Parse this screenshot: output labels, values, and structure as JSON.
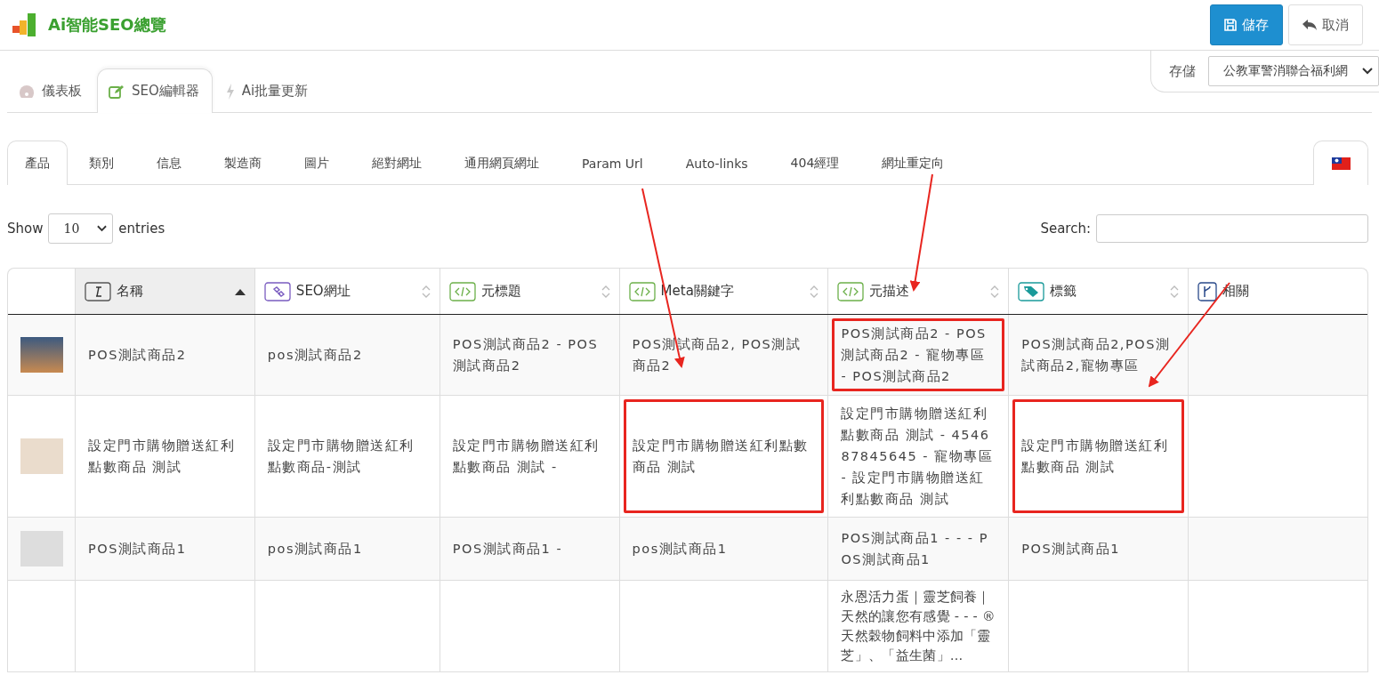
{
  "header": {
    "title": "Ai智能SEO總覽",
    "buttons": [
      {
        "kind": "save",
        "label": "儲存"
      },
      {
        "kind": "cancel",
        "label": "取消"
      }
    ]
  },
  "store": {
    "label": "存儲",
    "value": "公教軍警消聯合福利網"
  },
  "main_tabs": [
    {
      "kind": "dashboard",
      "label": "儀表板",
      "selected": false
    },
    {
      "kind": "edit",
      "label": "SEO編輯器",
      "selected": true
    },
    {
      "kind": "bolt",
      "label": "Ai批量更新",
      "selected": false
    }
  ],
  "sub_tabs": [
    {
      "label": "產品",
      "selected": true
    },
    {
      "label": "類別",
      "selected": false
    },
    {
      "label": "信息",
      "selected": false
    },
    {
      "label": "製造商",
      "selected": false
    },
    {
      "label": "圖片",
      "selected": false
    },
    {
      "label": "絕對網址",
      "selected": false
    },
    {
      "label": "通用網頁網址",
      "selected": false
    },
    {
      "label": "Param Url",
      "selected": false
    },
    {
      "label": "Auto-links",
      "selected": false
    },
    {
      "label": "404經理",
      "selected": false
    },
    {
      "label": "網址重定向",
      "selected": false
    }
  ],
  "entries": {
    "show": "Show",
    "value": "10",
    "suffix": "entries",
    "search_label": "Search:"
  },
  "table": {
    "columns": [
      {
        "kind": "text",
        "label": "名稱",
        "sortable": true,
        "sorted": true
      },
      {
        "kind": "link",
        "label": "SEO網址",
        "sortable": true,
        "sorted": false
      },
      {
        "kind": "code",
        "label": "元標題",
        "sortable": true,
        "sorted": false
      },
      {
        "kind": "code",
        "label": "Meta關鍵字",
        "sortable": true,
        "sorted": false
      },
      {
        "kind": "code",
        "label": "元描述",
        "sortable": true,
        "sorted": false
      },
      {
        "kind": "tag",
        "label": "標籤",
        "sortable": true,
        "sorted": false
      },
      {
        "kind": "fork",
        "label": "相關",
        "sortable": false,
        "sorted": false
      }
    ],
    "rows": [
      {
        "thumbnail": true,
        "cells": [
          {
            "text": "POS測試商品2",
            "highlighted": false
          },
          {
            "text": "pos測試商品2",
            "highlighted": false
          },
          {
            "text": "POS測試商品2 - POS測試商品2",
            "highlighted": false
          },
          {
            "text": "POS測試商品2, POS測試商品2",
            "highlighted": false
          },
          {
            "text": "POS測試商品2 - POS測試商品2 - 寵物專區 - POS測試商品2",
            "highlighted": true
          },
          {
            "text": "POS測試商品2,POS測試商品2,寵物專區",
            "highlighted": false
          },
          {
            "text": "",
            "highlighted": false
          }
        ]
      },
      {
        "thumbnail": true,
        "cells": [
          {
            "text": "設定門市購物贈送紅利點數商品 測試",
            "highlighted": false
          },
          {
            "text": "設定門市購物贈送紅利點數商品-測試",
            "highlighted": false
          },
          {
            "text": "設定門市購物贈送紅利點數商品 測試 -",
            "highlighted": false
          },
          {
            "text": "設定門市購物贈送紅利點數商品 測試",
            "highlighted": true
          },
          {
            "text": "設定門市購物贈送紅利點數商品 測試 - 454687845645 - 寵物專區 - 設定門市購物贈送紅利點數商品 測試",
            "highlighted": false
          },
          {
            "text": "設定門市購物贈送紅利點數商品 測試",
            "highlighted": true
          },
          {
            "text": "",
            "highlighted": false
          }
        ]
      },
      {
        "thumbnail": true,
        "cells": [
          {
            "text": "POS測試商品1",
            "highlighted": false
          },
          {
            "text": "pos測試商品1",
            "highlighted": false
          },
          {
            "text": "POS測試商品1 -",
            "highlighted": false
          },
          {
            "text": "pos測試商品1",
            "highlighted": false
          },
          {
            "text": "POS測試商品1 - - - POS測試商品1",
            "highlighted": false
          },
          {
            "text": "POS測試商品1",
            "highlighted": false
          },
          {
            "text": "",
            "highlighted": false
          }
        ]
      },
      {
        "thumbnail": false,
        "cells": [
          {
            "text": "",
            "highlighted": false
          },
          {
            "text": "",
            "highlighted": false
          },
          {
            "text": "",
            "highlighted": false
          },
          {
            "text": "",
            "highlighted": false
          },
          {
            "text": "永恩活力蛋｜靈芝飼養｜天然的讓您有感覺 - - - ®天然穀物飼料中添加「靈芝」、「益生菌」…",
            "highlighted": false
          },
          {
            "text": "",
            "highlighted": false
          },
          {
            "text": "",
            "highlighted": false
          }
        ]
      }
    ]
  }
}
